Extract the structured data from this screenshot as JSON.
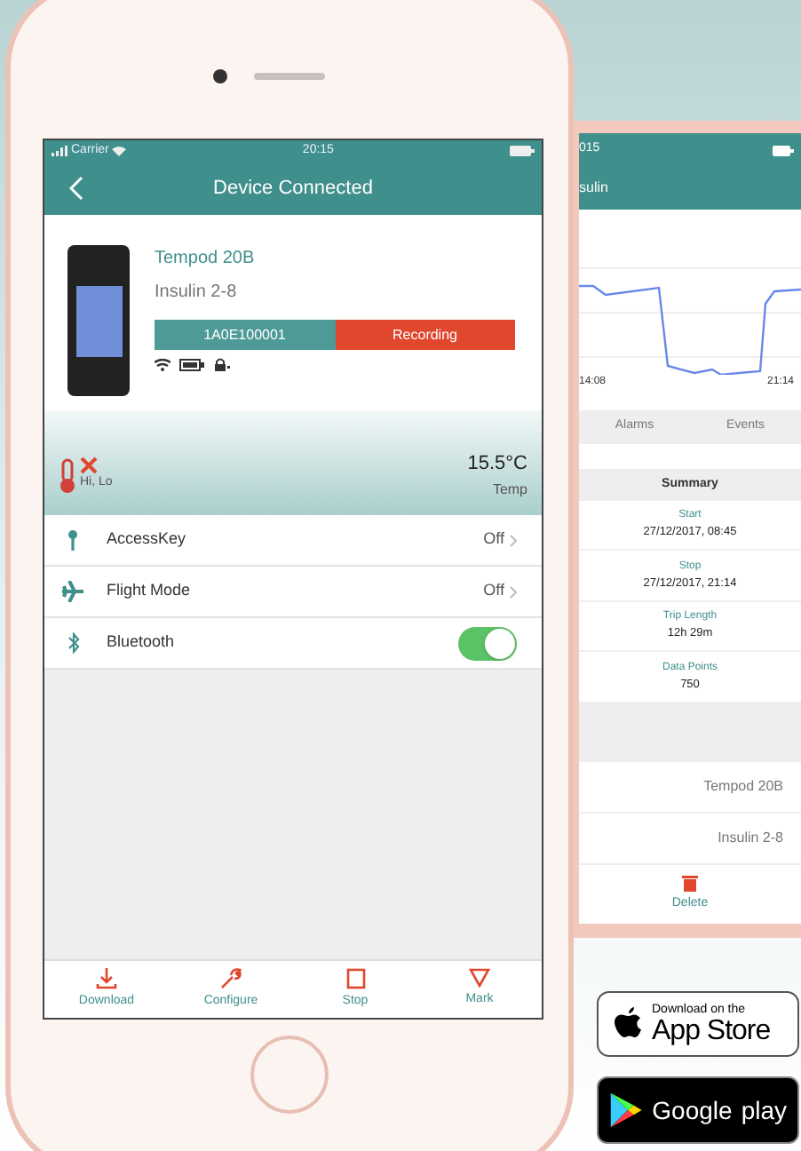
{
  "front_screen": {
    "status_bar": {
      "carrier": "Carrier",
      "time": "20:15"
    },
    "nav": {
      "title": "Device Connected"
    },
    "device": {
      "name": "Tempod 20B",
      "profile": "Insulin 2-8",
      "serial": "1A0E100001",
      "state": "Recording"
    },
    "reading": {
      "limits": "Hi, Lo",
      "value": "15.5°C",
      "label": "Temp"
    },
    "settings": [
      {
        "kind": "disclosure",
        "label": "AccessKey",
        "value": "Off"
      },
      {
        "kind": "disclosure",
        "label": "Flight Mode",
        "value": "Off"
      },
      {
        "kind": "toggle",
        "label": "Bluetooth",
        "on": true
      }
    ],
    "toolbar": [
      {
        "label": "Download"
      },
      {
        "label": "Configure"
      },
      {
        "label": "Stop"
      },
      {
        "label": "Mark"
      }
    ]
  },
  "back_screen": {
    "status_bar": {
      "time": "015"
    },
    "nav": {
      "title": "sulin"
    },
    "chart_axis": [
      "14:08",
      "21:14"
    ],
    "tabs": [
      {
        "label": "Alarms",
        "selected": false
      },
      {
        "label": "Events",
        "selected": false
      }
    ],
    "summary": {
      "title": "Summary",
      "items": [
        {
          "label": "Start",
          "value": "27/12/2017, 08:45"
        },
        {
          "label": "Stop",
          "value": "27/12/2017, 21:14"
        },
        {
          "label": "Trip Length",
          "value": "12h 29m"
        },
        {
          "label": "Data Points",
          "value": "750"
        }
      ]
    },
    "details": [
      "Tempod 20B",
      "Insulin 2-8"
    ],
    "action": "Delete"
  },
  "badges": {
    "app_store": {
      "small": "Download on the",
      "large": "App Store"
    },
    "google_play": {
      "brand": "Google",
      "word": "play"
    }
  }
}
